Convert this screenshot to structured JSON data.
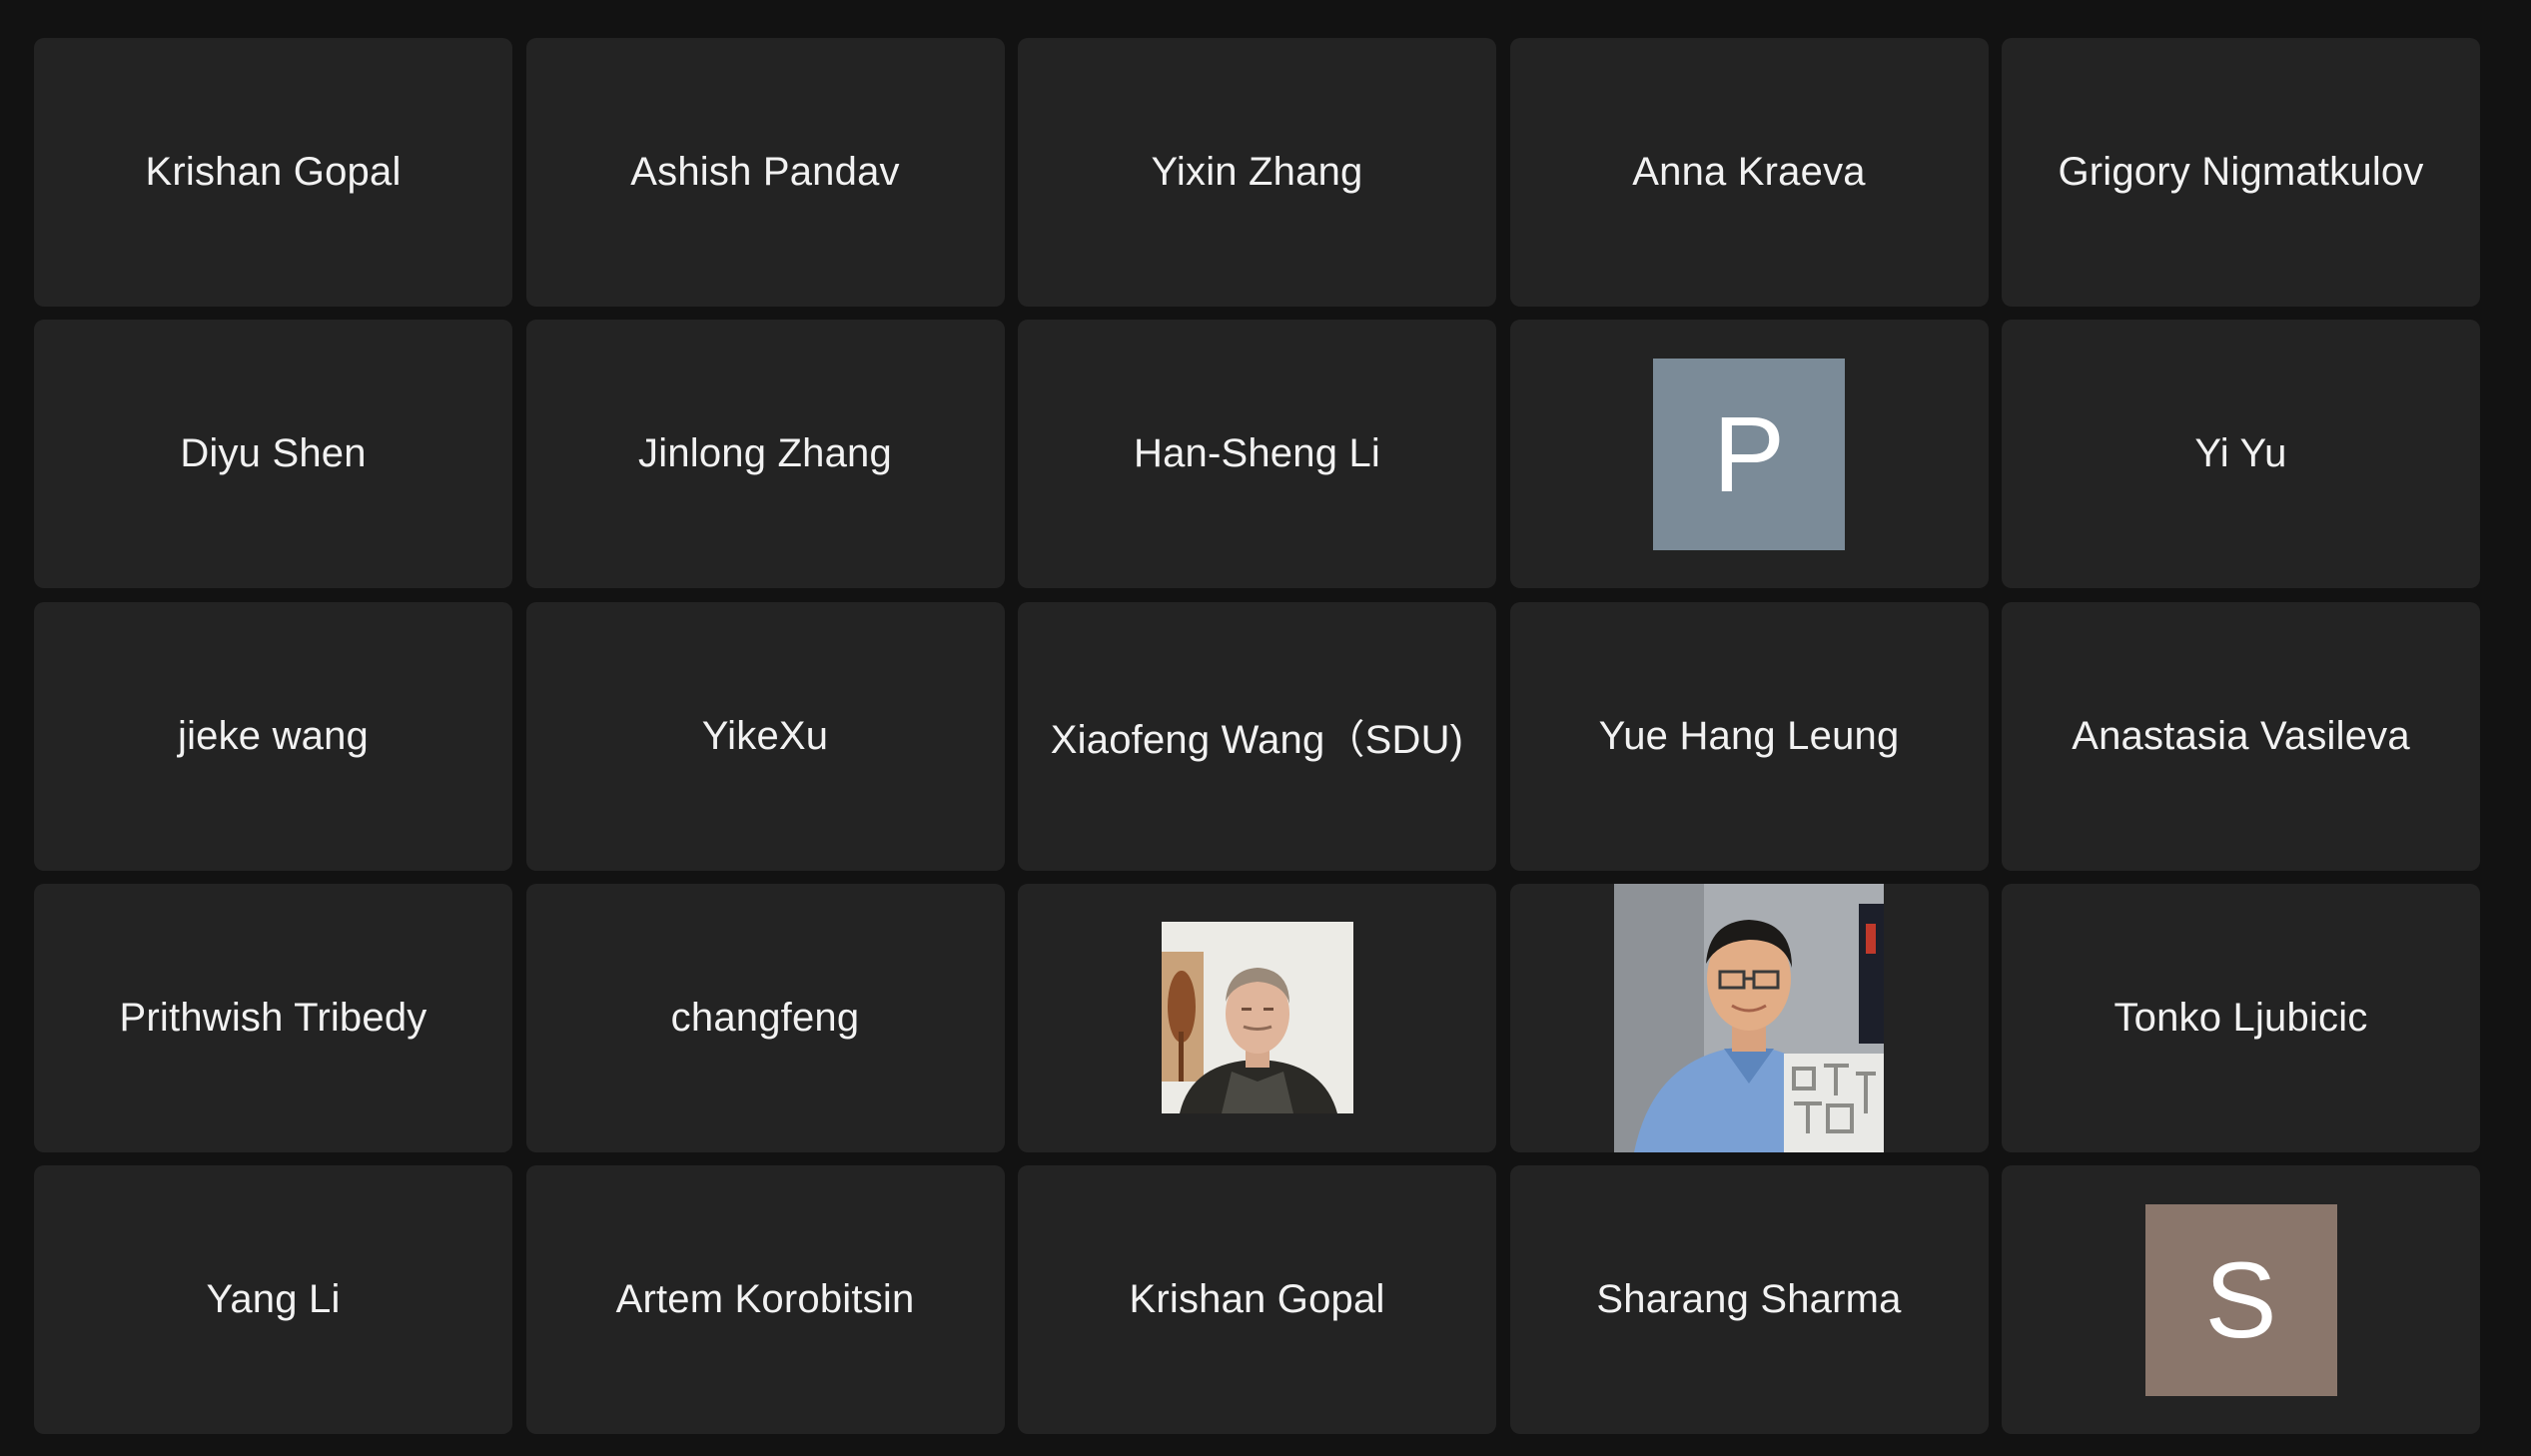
{
  "participants": [
    {
      "name": "Krishan Gopal"
    },
    {
      "name": "Ashish Pandav"
    },
    {
      "name": "Yixin Zhang"
    },
    {
      "name": "Anna Kraeva"
    },
    {
      "name": "Grigory Nigmatkulov"
    },
    {
      "name": "Diyu Shen"
    },
    {
      "name": "Jinlong Zhang"
    },
    {
      "name": "Han-Sheng Li"
    },
    {
      "avatar_letter": "P",
      "avatar_color": "#7b8b98"
    },
    {
      "name": "Yi Yu"
    },
    {
      "name": "jieke wang"
    },
    {
      "name": "YikeXu"
    },
    {
      "name": "Xiaofeng Wang（SDU)"
    },
    {
      "name": "Yue Hang Leung"
    },
    {
      "name": "Anastasia Vasileva"
    },
    {
      "name": "Prithwish Tribedy"
    },
    {
      "name": "changfeng"
    },
    {
      "photo": "profile-photo-man-gray-hair"
    },
    {
      "photo": "profile-photo-man-glasses-blue-shirt"
    },
    {
      "name": "Tonko Ljubicic"
    },
    {
      "name": "Yang Li"
    },
    {
      "name": "Artem Korobitsin"
    },
    {
      "name": "Krishan Gopal"
    },
    {
      "name": "Sharang Sharma"
    },
    {
      "avatar_letter": "S",
      "avatar_color": "#8a766b"
    }
  ],
  "colors": {
    "background": "#121212",
    "tile": "#232323",
    "text": "#f2f2f2"
  }
}
